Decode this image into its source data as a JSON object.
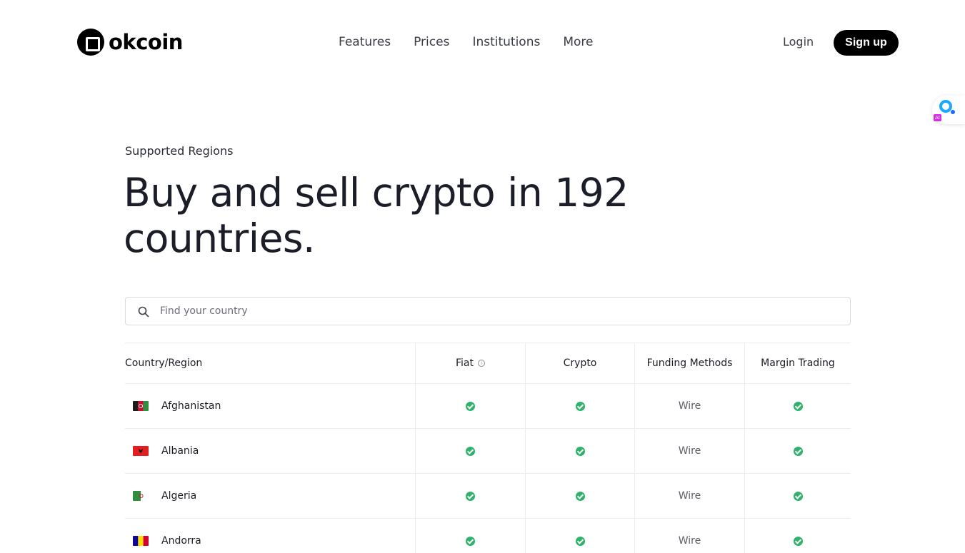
{
  "header": {
    "logo_text": "okcoin",
    "nav": [
      "Features",
      "Prices",
      "Institutions",
      "More"
    ],
    "login_label": "Login",
    "signup_label": "Sign up",
    "ai_badge": "AI"
  },
  "hero": {
    "eyebrow": "Supported Regions",
    "headline_line1": "Buy and sell crypto in 192",
    "headline_line2": "countries."
  },
  "search": {
    "placeholder": "Find your country"
  },
  "table": {
    "columns": [
      "Country/Region",
      "Fiat",
      "Crypto",
      "Funding Methods",
      "Margin Trading"
    ],
    "rows": [
      {
        "country": "Afghanistan",
        "fiat": true,
        "crypto": true,
        "funding": "Wire",
        "margin": true
      },
      {
        "country": "Albania",
        "fiat": true,
        "crypto": true,
        "funding": "Wire",
        "margin": true
      },
      {
        "country": "Algeria",
        "fiat": true,
        "crypto": true,
        "funding": "Wire",
        "margin": true
      },
      {
        "country": "Andorra",
        "fiat": true,
        "crypto": true,
        "funding": "Wire",
        "margin": true
      }
    ]
  },
  "colors": {
    "check": "#2fb36b",
    "signup_bg": "#000000",
    "ai_accent": "#1aa7ff"
  }
}
